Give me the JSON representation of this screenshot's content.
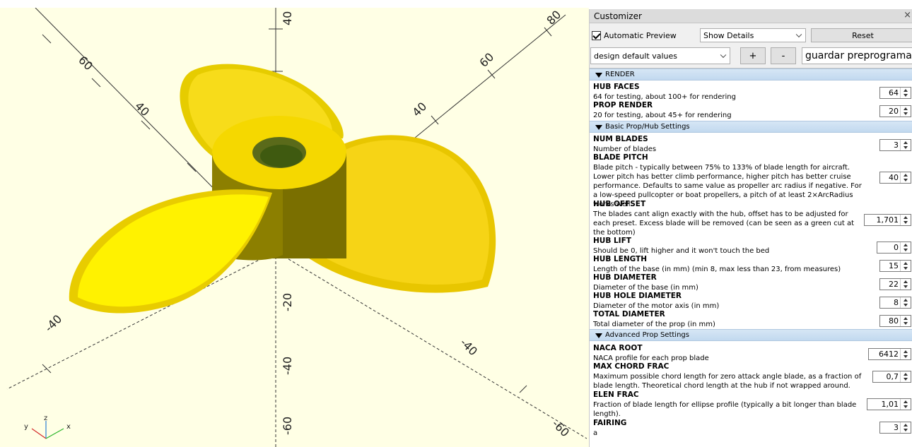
{
  "viewport": {
    "background": "#ffffe5",
    "model_color": "#ffe500",
    "axis_labels": {
      "x": "x",
      "y": "y",
      "z": "z"
    }
  },
  "customizer": {
    "title": "Customizer",
    "close": "×",
    "automatic_preview": "Automatic Preview",
    "details_select": "Show Details",
    "reset": "Reset",
    "preset_select": "design default values",
    "plus": "+",
    "minus": "-",
    "preset_name": "guardar preprogramado",
    "groups": [
      {
        "name": "RENDER",
        "params": [
          {
            "name": "HUB FACES",
            "desc": "64 for testing, about 100+ for rendering",
            "value": "64"
          },
          {
            "name": "PROP RENDER",
            "desc": "20 for testing, about 45+ for rendering",
            "value": "20"
          }
        ]
      },
      {
        "name": "Basic Prop/Hub Settings",
        "params": [
          {
            "name": "NUM BLADES",
            "desc": "Number of blades",
            "value": "3"
          },
          {
            "name": "BLADE PITCH",
            "desc": "Blade pitch - typically between 75% to 133% of blade length for aircraft. Lower pitch has better climb performance, higher pitch has better cruise performance. Defaults to same value as propeller arc radius if negative. For a low-speed pullcopter or boat propellers, a pitch of at least 2×ArcRadius works well.",
            "value": "40"
          },
          {
            "name": "HUB OFFSET",
            "desc": "The blades cant align exactly with the hub, offset has to be adjusted for each preset. Excess blade will be removed (can be seen as a green cut at the bottom)",
            "value": "1,701"
          },
          {
            "name": "HUB LIFT",
            "desc": "Should be 0, lift higher and it won't touch the bed",
            "value": "0"
          },
          {
            "name": "HUB LENGTH",
            "desc": "Length of the base (in mm) (min 8, max less than 23, from measures)",
            "value": "15"
          },
          {
            "name": "HUB DIAMETER",
            "desc": "Diameter of the base (in mm)",
            "value": "22"
          },
          {
            "name": "HUB HOLE DIAMETER",
            "desc": "Diameter of the motor axis (in mm)",
            "value": "8"
          },
          {
            "name": "TOTAL DIAMETER",
            "desc": "Total diameter of the prop (in mm)",
            "value": "80"
          }
        ]
      },
      {
        "name": "Advanced Prop Settings",
        "params": [
          {
            "name": "NACA ROOT",
            "desc": "NACA profile for each prop blade",
            "value": "6412"
          },
          {
            "name": "MAX CHORD FRAC",
            "desc": "Maximum possible chord length for zero attack angle blade, as a fraction of blade length. Theoretical chord length at the hub if not wrapped around.",
            "value": "0,7"
          },
          {
            "name": "ELEN FRAC",
            "desc": "Fraction of blade length for ellipse profile (typically a bit longer than blade length).",
            "value": "1,01"
          },
          {
            "name": "FAIRING",
            "desc": "a",
            "value": "3"
          }
        ]
      }
    ]
  }
}
